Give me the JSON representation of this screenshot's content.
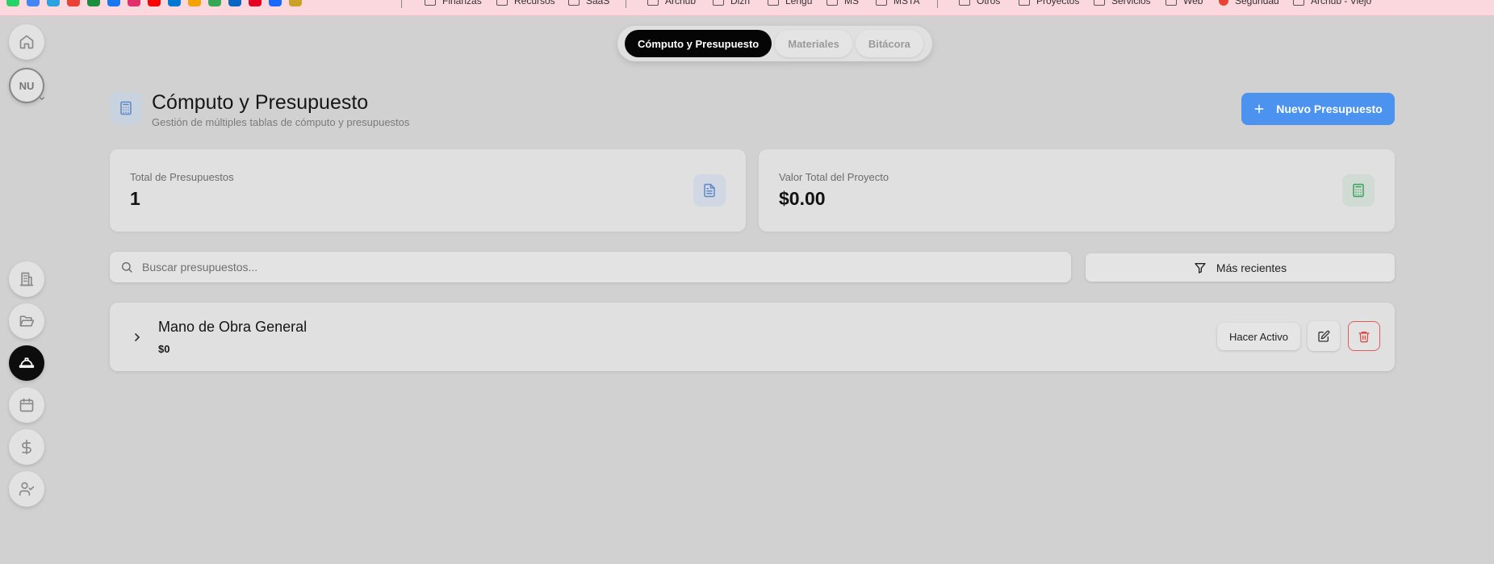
{
  "bookmarks": {
    "items": [
      {
        "label": "Finanzas"
      },
      {
        "label": "Recursos"
      },
      {
        "label": "SaaS"
      },
      {
        "label": "Archub"
      },
      {
        "label": "Dizñ"
      },
      {
        "label": "Lengu"
      },
      {
        "label": "MS"
      },
      {
        "label": "MSTA"
      },
      {
        "label": "Otros"
      },
      {
        "label": "Proyectos"
      },
      {
        "label": "Servicios"
      },
      {
        "label": "Web"
      },
      {
        "label": "Seguridad"
      },
      {
        "label": "Archub - Viejo"
      }
    ],
    "icon_colors": [
      "#25d366",
      "#4285f4",
      "#2aa3e0",
      "#ea4335",
      "#1e8e3e",
      "#1877f2",
      "#e1306c",
      "#ff0000",
      "#0078d4",
      "#f4a300",
      "#34a853",
      "#0a66c2",
      "#e60023",
      "#1769ff",
      "#c9a227"
    ]
  },
  "rail": {
    "avatar_initials": "NU",
    "items": [
      {
        "icon": "home-icon"
      },
      {
        "icon": "building-icon"
      },
      {
        "icon": "folder-open-icon"
      },
      {
        "icon": "hard-hat-icon",
        "active": true
      },
      {
        "icon": "calendar-icon"
      },
      {
        "icon": "dollar-icon"
      },
      {
        "icon": "user-check-icon"
      }
    ]
  },
  "tabs": {
    "items": [
      {
        "label": "Cómputo y Presupuesto",
        "active": true
      },
      {
        "label": "Materiales"
      },
      {
        "label": "Bitácora"
      }
    ]
  },
  "header": {
    "title": "Cómputo y Presupuesto",
    "subtitle": "Gestión de múltiples tablas de cómputo y presupuestos",
    "new_button": "Nuevo Presupuesto",
    "accent": "#4b93ee"
  },
  "stats": {
    "total_label": "Total de Presupuestos",
    "total_value": "1",
    "value_label": "Valor Total del Proyecto",
    "value_value": "$0.00",
    "total_icon_color": "#5b88c6",
    "value_icon_color": "#3aa35c"
  },
  "search": {
    "placeholder": "Buscar presupuestos...",
    "value": ""
  },
  "filter": {
    "label": "Más recientes"
  },
  "budgets": [
    {
      "name": "Mano de Obra General",
      "amount": "$0",
      "make_active_label": "Hacer Activo"
    }
  ]
}
